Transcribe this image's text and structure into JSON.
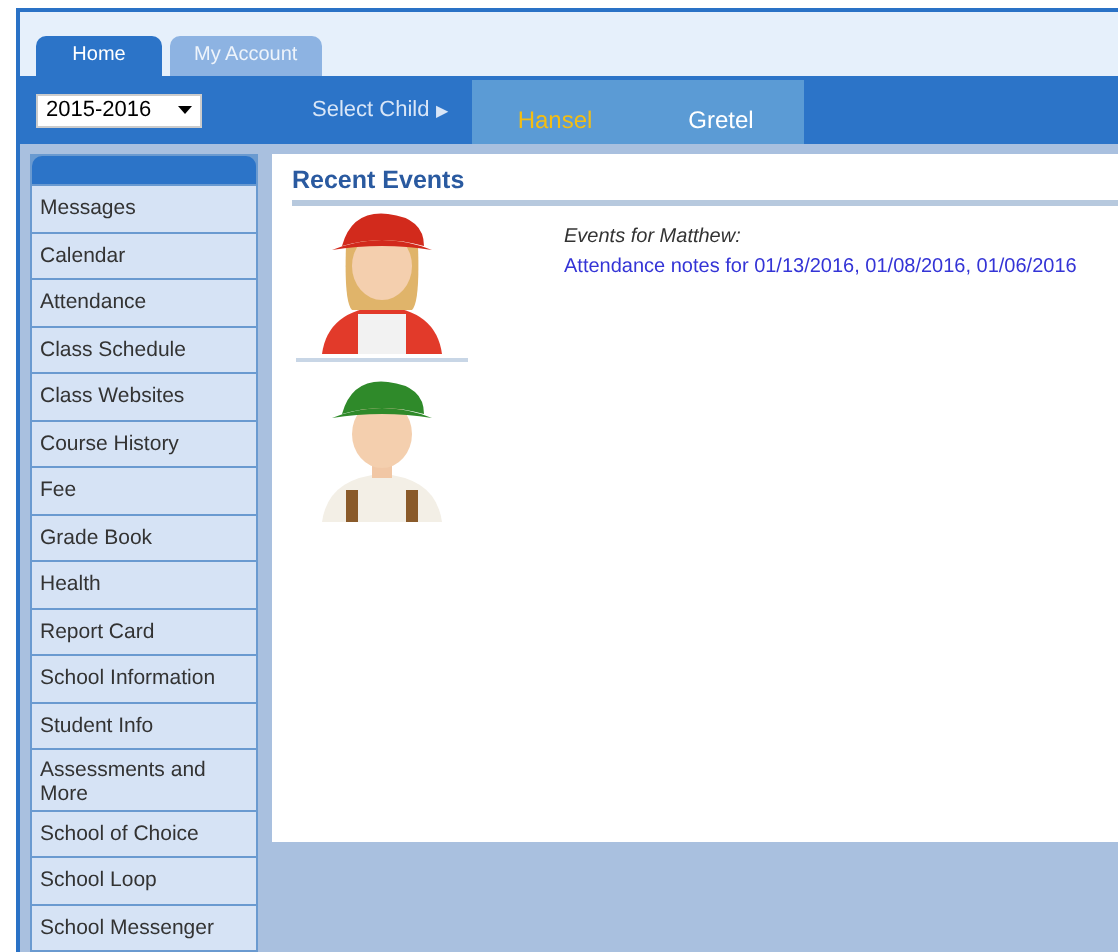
{
  "tabs": [
    {
      "label": "Home",
      "selected": true
    },
    {
      "label": "My Account",
      "selected": false
    }
  ],
  "year_select": {
    "value": "2015-2016"
  },
  "child_selector": {
    "label": "Select Child",
    "arrow": "▶",
    "children": [
      {
        "name": "Hansel",
        "selected": true
      },
      {
        "name": "Gretel",
        "selected": false
      }
    ]
  },
  "sidebar": {
    "items": [
      "Messages",
      "Calendar",
      "Attendance",
      "Class Schedule",
      "Class Websites",
      "Course History",
      "Fee",
      "Grade Book",
      "Health",
      "Report Card",
      "School Information",
      "Student Info",
      "Assessments and More",
      "School of Choice",
      "School Loop",
      "School Messenger"
    ]
  },
  "recent_events": {
    "title": "Recent Events",
    "students": [
      {
        "picture": {
          "kind": "picture"
        },
        "heading": "Events for Matthew:",
        "links": [
          "Attendance notes for 01/13/2016, 01/08/2016, 01/06/2016"
        ]
      },
      {
        "picture": {
          "kind": "picture"
        }
      }
    ]
  }
}
